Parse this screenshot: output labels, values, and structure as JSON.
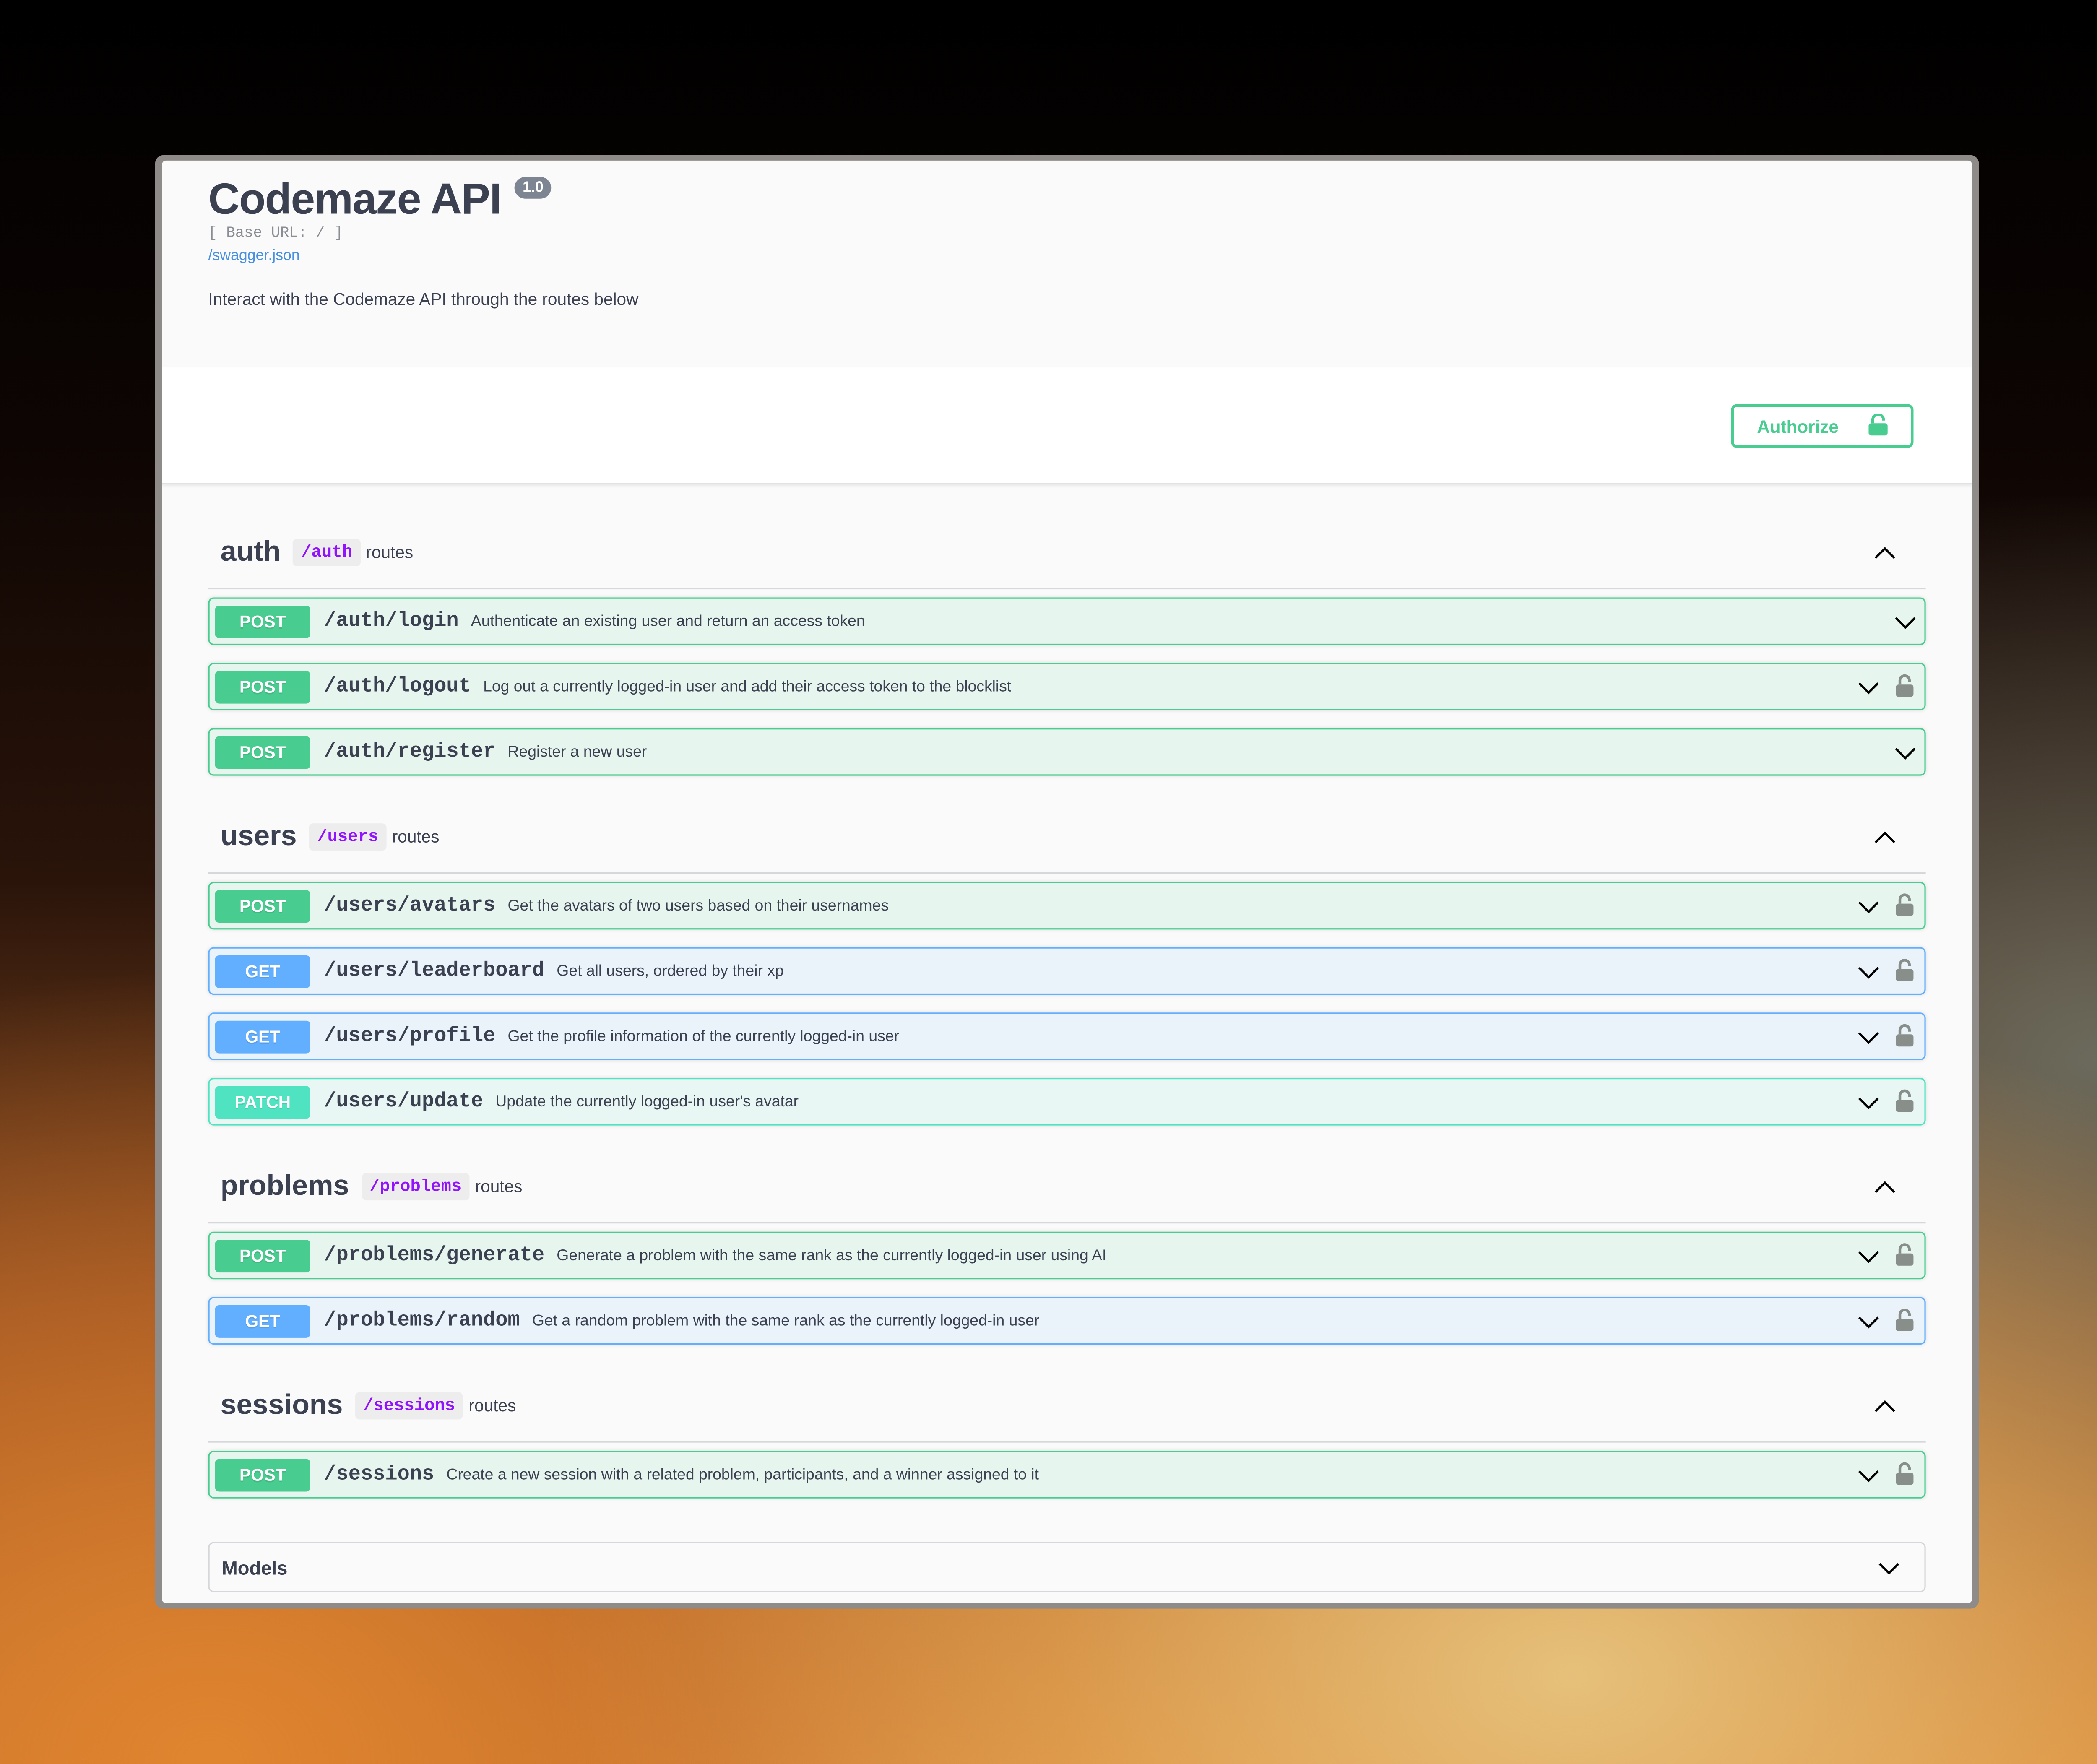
{
  "header": {
    "title": "Codemaze API",
    "version": "1.0",
    "base_url": "[ Base URL: / ]",
    "spec_link": "/swagger.json",
    "description": "Interact with the Codemaze API through the routes below"
  },
  "authorize": {
    "label": "Authorize",
    "icon": "unlock-icon"
  },
  "colors": {
    "POST": "#49cc90",
    "GET": "#61affe",
    "PATCH": "#50e3c2"
  },
  "tags": [
    {
      "name": "auth",
      "path": "/auth",
      "suffix": "routes",
      "operations": [
        {
          "method": "POST",
          "path": "/auth/login",
          "description": "Authenticate an existing user and return an access token",
          "locked": false
        },
        {
          "method": "POST",
          "path": "/auth/logout",
          "description": "Log out a currently logged-in user and add their access token to the blocklist",
          "locked": true
        },
        {
          "method": "POST",
          "path": "/auth/register",
          "description": "Register a new user",
          "locked": false
        }
      ]
    },
    {
      "name": "users",
      "path": "/users",
      "suffix": "routes",
      "operations": [
        {
          "method": "POST",
          "path": "/users/avatars",
          "description": "Get the avatars of two users based on their usernames",
          "locked": true
        },
        {
          "method": "GET",
          "path": "/users/leaderboard",
          "description": "Get all users, ordered by their xp",
          "locked": true
        },
        {
          "method": "GET",
          "path": "/users/profile",
          "description": "Get the profile information of the currently logged-in user",
          "locked": true
        },
        {
          "method": "PATCH",
          "path": "/users/update",
          "description": "Update the currently logged-in user's avatar",
          "locked": true
        }
      ]
    },
    {
      "name": "problems",
      "path": "/problems",
      "suffix": "routes",
      "operations": [
        {
          "method": "POST",
          "path": "/problems/generate",
          "description": "Generate a problem with the same rank as the currently logged-in user using AI",
          "locked": true
        },
        {
          "method": "GET",
          "path": "/problems/random",
          "description": "Get a random problem with the same rank as the currently logged-in user",
          "locked": true
        }
      ]
    },
    {
      "name": "sessions",
      "path": "/sessions",
      "suffix": "routes",
      "operations": [
        {
          "method": "POST",
          "path": "/sessions",
          "description": "Create a new session with a related problem, participants, and a winner assigned to it",
          "locked": true
        }
      ]
    }
  ],
  "models": {
    "label": "Models"
  }
}
